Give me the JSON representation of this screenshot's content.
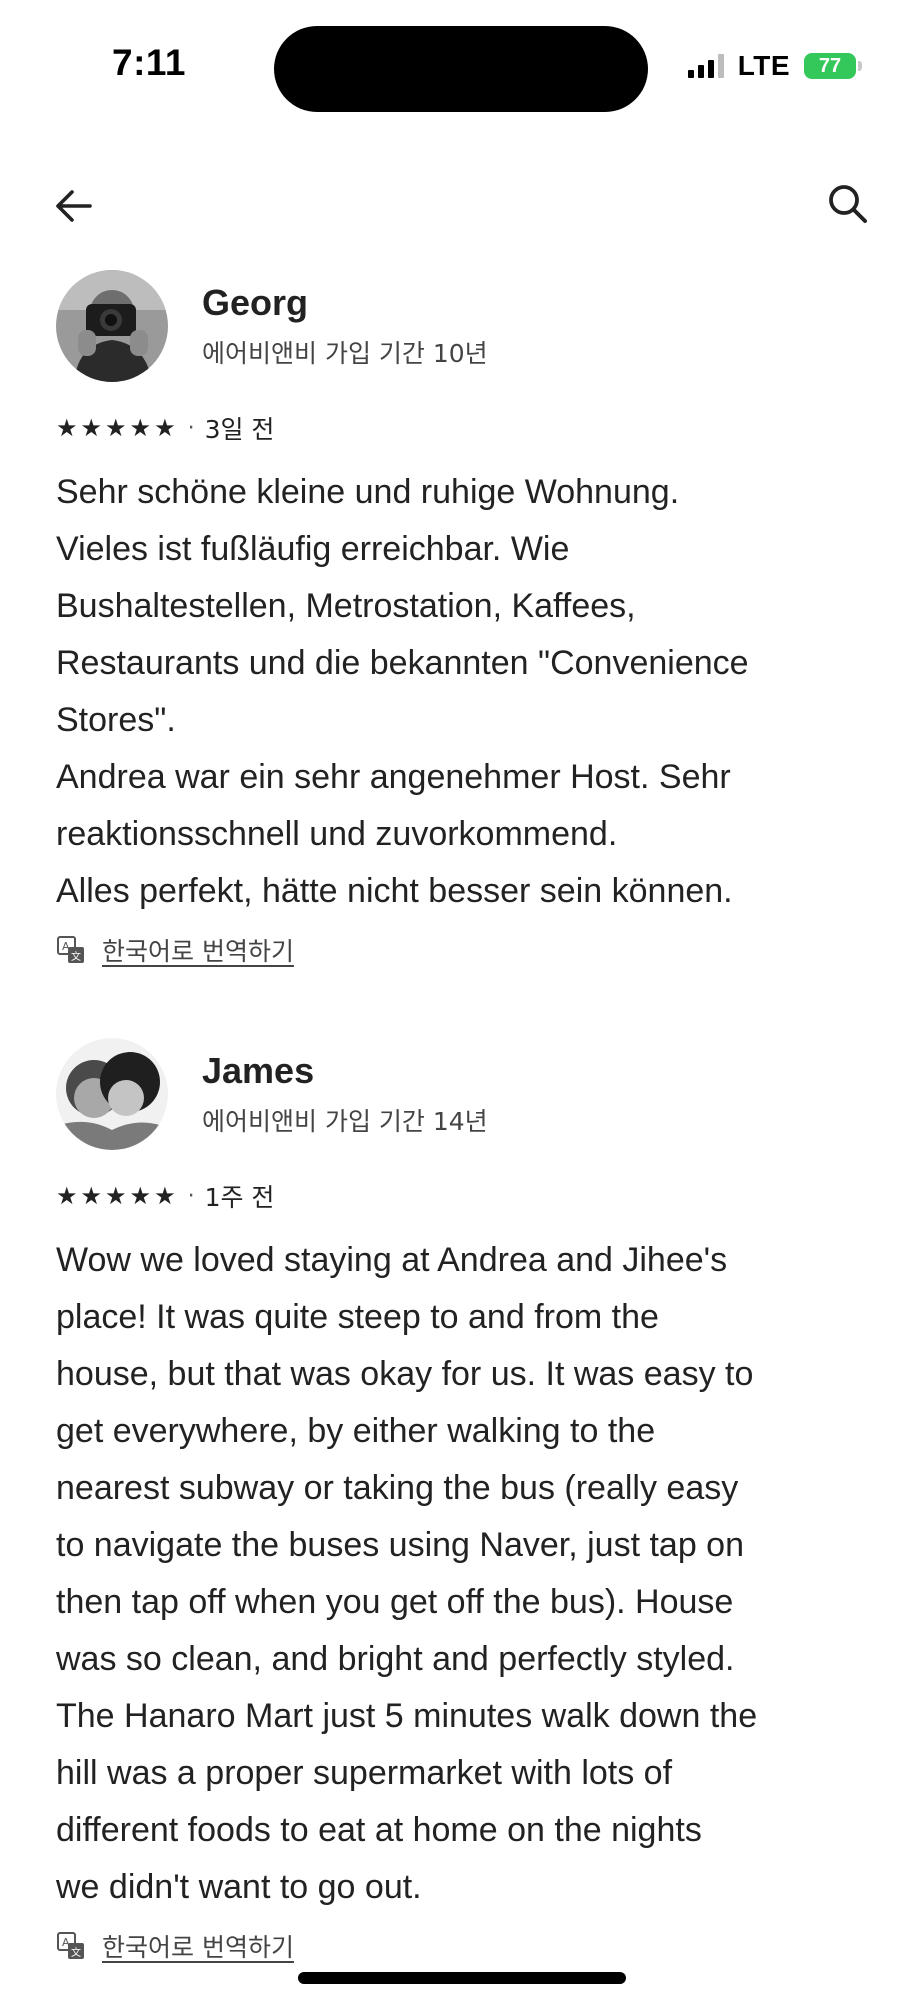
{
  "status_bar": {
    "time": "7:11",
    "network": "LTE",
    "battery": "77"
  },
  "nav": {
    "back_icon": "arrow-left-icon",
    "search_icon": "search-icon"
  },
  "reviews": [
    {
      "name": "Georg",
      "tenure": "에어비앤비 가입 기간 10년",
      "stars": 5,
      "date": "3일 전",
      "text": "Sehr schöne kleine und ruhige Wohnung.\nVieles ist fußläufig erreichbar. Wie\nBushaltestellen, Metrostation, Kaffees,\nRestaurants und die bekannten \"Convenience\nStores\".\nAndrea war ein sehr angenehmer Host. Sehr\nreaktionsschnell und zuvorkommend.\nAlles perfekt, hätte nicht besser sein können.",
      "translate": "한국어로 번역하기"
    },
    {
      "name": "James",
      "tenure": "에어비앤비 가입 기간 14년",
      "stars": 5,
      "date": "1주 전",
      "text": "Wow we loved staying at Andrea and Jihee's\nplace! It was quite steep to and from the\nhouse, but that was okay for us. It was easy to\nget everywhere, by either walking to the\nnearest subway or taking the bus (really easy\nto navigate the buses using Naver, just tap on\nthen tap off when you get off the bus). House\nwas so clean, and bright and perfectly styled.\nThe Hanaro Mart just 5 minutes walk down the\nhill was a proper supermarket with lots of\ndifferent foods to eat at home on the nights\nwe didn't want to go out.",
      "translate": "한국어로 번역하기"
    }
  ],
  "colors": {
    "text": "#222222",
    "secondary": "#444444",
    "battery": "#34c759"
  }
}
